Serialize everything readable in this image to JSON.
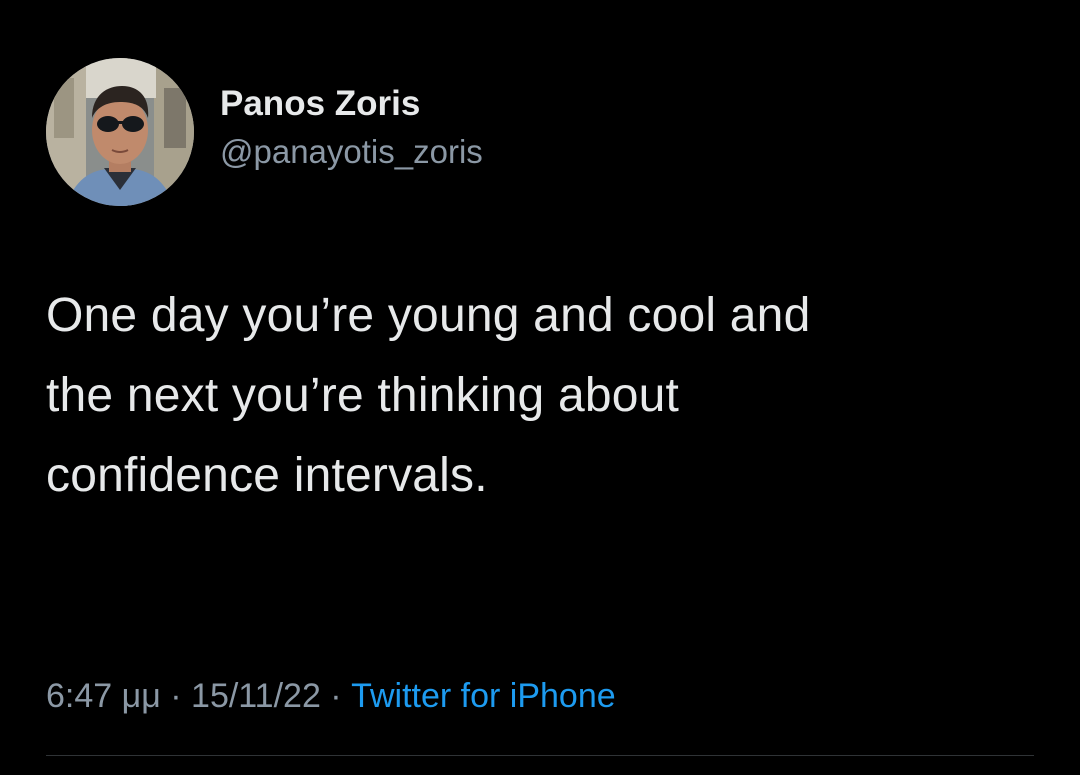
{
  "author": {
    "display_name": "Panos Zoris",
    "handle": "@panayotis_zoris"
  },
  "tweet": {
    "text": "One day you’re young and cool and\nthe next you’re thinking about\nconfidence intervals."
  },
  "meta": {
    "time": "6:47 μμ",
    "separator": " · ",
    "date": "15/11/22",
    "source": "Twitter for iPhone"
  },
  "colors": {
    "background": "#000000",
    "primary_text": "#e7e9ea",
    "secondary_text": "#8b98a5",
    "link": "#1d9bf0"
  },
  "icons": {
    "avatar": "profile-photo"
  }
}
